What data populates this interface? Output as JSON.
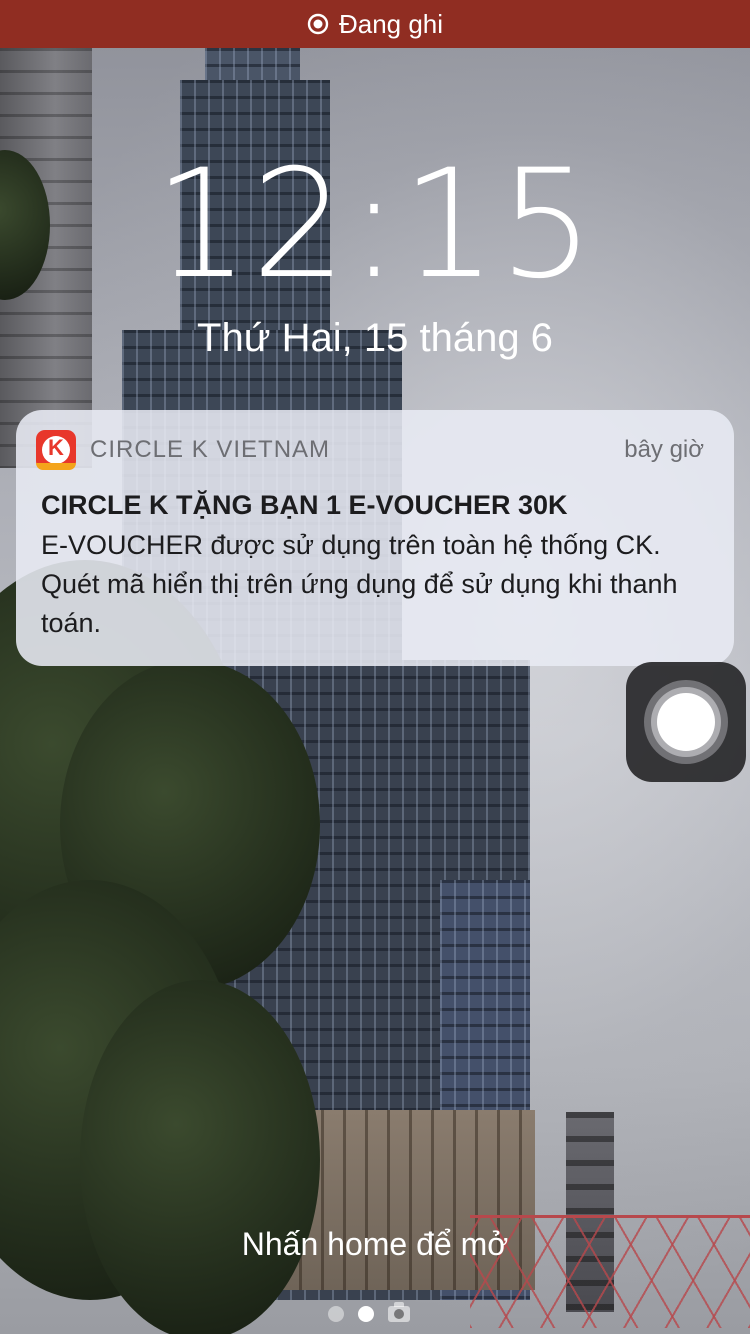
{
  "status_banner": {
    "icon": "recording-icon",
    "label": "Đang ghi",
    "color": "#902d22"
  },
  "lock_screen": {
    "time": "12:15",
    "date": "Thứ Hai, 15 tháng 6",
    "unlock_hint": "Nhấn home để mở"
  },
  "notification": {
    "app_icon": "circle-k-icon",
    "app_icon_letter": "K",
    "app_name": "CIRCLE K VIETNAM",
    "time": "bây giờ",
    "title": "CIRCLE K TẶNG BẠN 1 E-VOUCHER 30K",
    "body": "E-VOUCHER được sử dụng trên toàn hệ thống CK. Quét mã hiển thị trên ứng dụng để sử dụng khi thanh toán."
  },
  "assistive_touch": {
    "icon": "assistive-touch-icon"
  },
  "page_indicator": {
    "items": [
      "dot",
      "dot",
      "camera-icon"
    ],
    "active_index": 1
  }
}
